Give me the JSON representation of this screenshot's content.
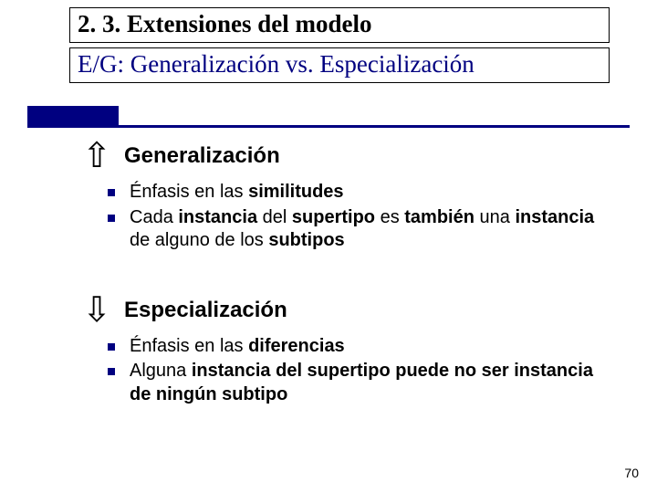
{
  "title": "2. 3. Extensiones del modelo",
  "subtitle": "E/G: Generalización vs. Especialización",
  "sections": [
    {
      "arrow": "⇧",
      "heading": "Generalización",
      "bullets": [
        {
          "pre": "Énfasis en las ",
          "b1": "similitudes",
          "post": ""
        },
        {
          "pre": "Cada ",
          "b1": "instancia",
          "mid1": " del ",
          "b2": "supertipo",
          "mid2": " es ",
          "b3": "también",
          "mid3": " una ",
          "b4": "instancia",
          "mid4": " de alguno de los ",
          "b5": "subtipos",
          "post": ""
        }
      ]
    },
    {
      "arrow": "⇩",
      "heading": "Especialización",
      "bullets": [
        {
          "pre": "Énfasis en las ",
          "b1": "diferencias",
          "post": ""
        },
        {
          "pre": "Alguna ",
          "b1": "instancia del supertipo puede no ser instancia de ningún subtipo",
          "post": ""
        }
      ]
    }
  ],
  "slide_number": "70"
}
